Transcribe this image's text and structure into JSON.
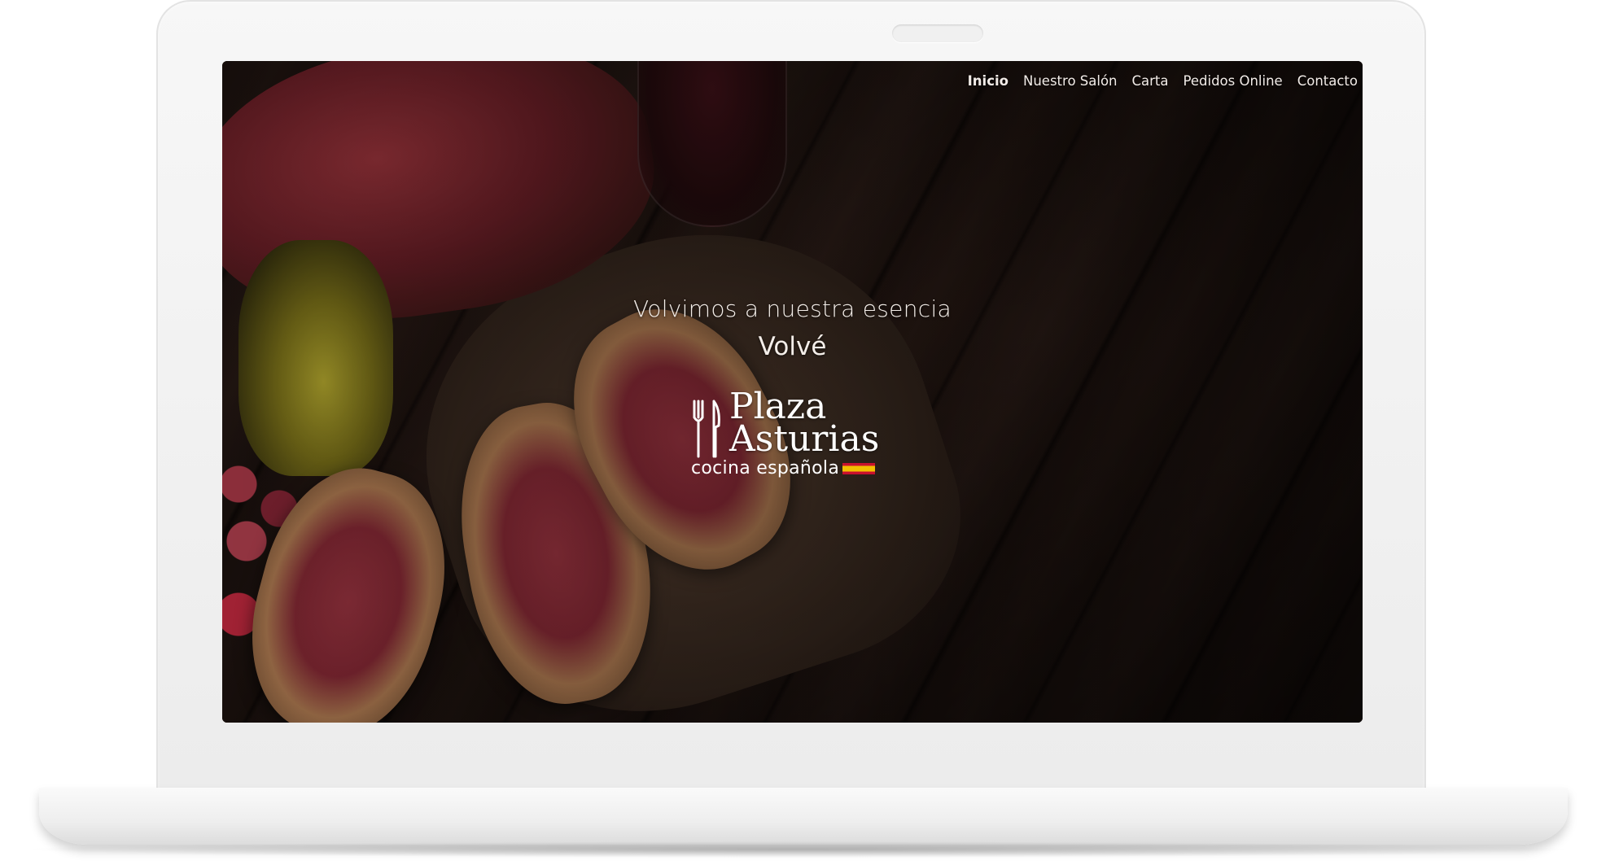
{
  "nav": {
    "items": [
      {
        "label": "Inicio",
        "active": true
      },
      {
        "label": "Nuestro Salón",
        "active": false
      },
      {
        "label": "Carta",
        "active": false
      },
      {
        "label": "Pedidos Online",
        "active": false
      },
      {
        "label": "Contacto",
        "active": false
      }
    ]
  },
  "hero": {
    "line1": "Volvimos a nuestra esencia",
    "line2": "Volvé"
  },
  "logo": {
    "name_line1": "Plaza",
    "name_line2": "Asturias",
    "tagline": "cocina española",
    "icon": "fork-knife-icon",
    "flag": "spain-flag-icon"
  },
  "colors": {
    "text": "#f4eee9",
    "flag_red": "#c8102e",
    "flag_yellow": "#f1bf00",
    "bezel": "#f2f2f2"
  }
}
